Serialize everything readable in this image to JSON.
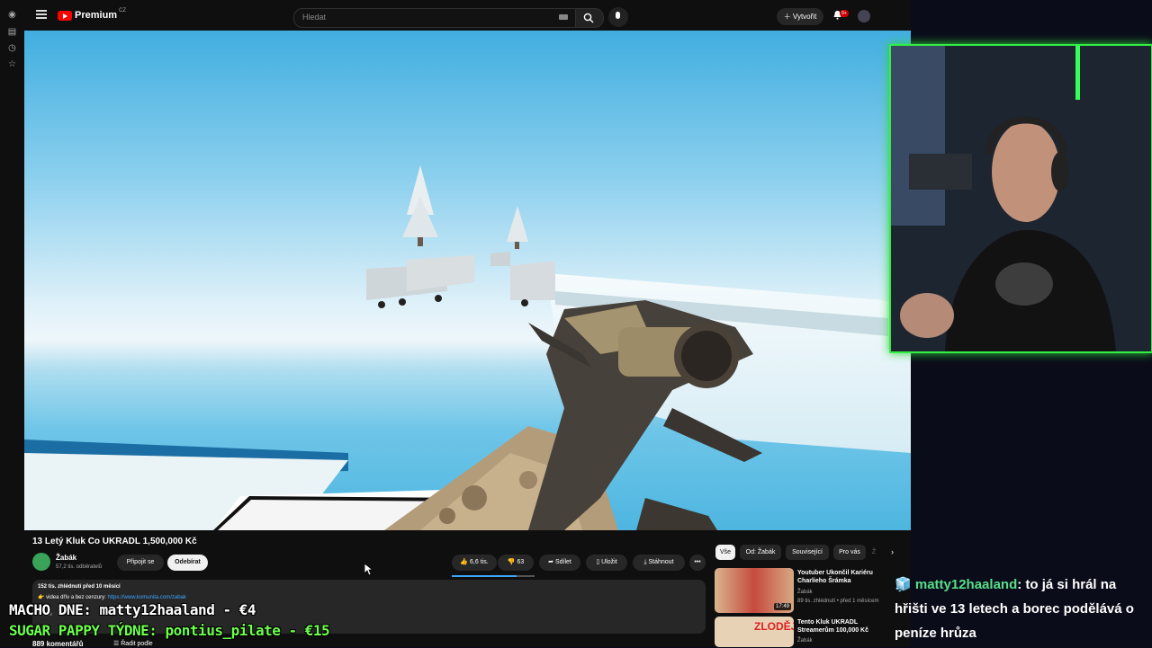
{
  "youtube": {
    "logo_text": "Premium",
    "logo_region": "CZ",
    "search_placeholder": "Hledat",
    "create_label": "Vytvořit",
    "notif_badge": "9+"
  },
  "video": {
    "title": "13 Letý Kluk Co UKRADL 1,500,000 Kč",
    "channel_name": "Žabák",
    "channel_subs": "57,2 tis. odběratelů",
    "join_label": "Připojit se",
    "subscribe_label": "Odebírat",
    "likes": "6,6 tis.",
    "dislikes": "63",
    "share_label": "Sdílet",
    "save_label": "Uložit",
    "download_label": "Stáhnout",
    "like_ratio": 0.78
  },
  "description": {
    "stats": "152 tis. zhlédnutí  před 10 měsíci",
    "line2_text": "videa dřív a bez cenzury: ",
    "line2_link": "https://www.komunita.com/zabak",
    "more": "...více"
  },
  "comments": {
    "count": "889 komentářů",
    "sort_label": "Řadit podle"
  },
  "chips": [
    "Vše",
    "Od: Žabák",
    "Související",
    "Pro vás"
  ],
  "recommendations": [
    {
      "title": "Youtuber Ukončil Kariéru Charlieho Šrámka",
      "channel": "Žabák",
      "meta": "89 tis. zhlédnutí • před 1 měsícem",
      "duration": "17:49"
    },
    {
      "title": "Tento Kluk UKRADL Streamerům 100,000 Kč",
      "channel": "Žabák",
      "thumb_text": "ZLODĚJ"
    }
  ],
  "overlay": {
    "macho_line": "MACHO DNE: matty12haaland - €4",
    "sugar_line": "SUGAR PAPPY TÝDNE: pontius_pilate - €15"
  },
  "chat": {
    "username": "matty12haaland",
    "message": ": to já si hrál na hřišti ve 13 letech a borec podělává o peníze hrůza"
  },
  "colors": {
    "cam_border": "#33ee44",
    "chat_user": "#55e08a",
    "sugar_text": "#6cff4c",
    "yt_red": "#ff0000"
  }
}
